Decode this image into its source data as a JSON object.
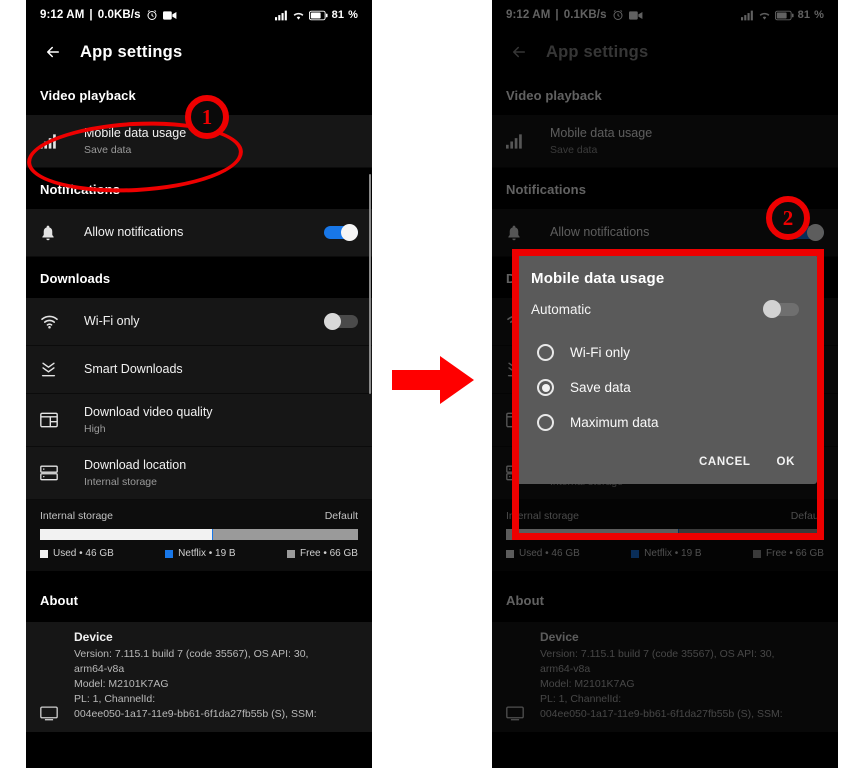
{
  "annotations": {
    "marker_1": "1",
    "marker_2": "2",
    "flow_arrow": "right-arrow"
  },
  "left_phone": {
    "status_bar": {
      "time": "9:12 AM",
      "separator": "|",
      "net_speed": "0.0KB/s",
      "alarm_icon": "alarm-clock-icon",
      "recording_icon": "screen-record-icon",
      "signal_icon": "cellular-signal-icon",
      "wifi_icon": "wifi-icon",
      "battery_icon": "battery-icon",
      "battery_level": "81"
    },
    "app_bar": {
      "back_icon": "back-arrow-icon",
      "title": "App settings"
    },
    "sections": [
      {
        "heading": "Video playback",
        "rows": [
          {
            "icon": "signal-bars-icon",
            "title": "Mobile data usage",
            "subtitle": "Save data",
            "control": "none"
          }
        ]
      },
      {
        "heading": "Notifications",
        "rows": [
          {
            "icon": "bell-icon",
            "title": "Allow notifications",
            "subtitle": "",
            "control": "toggle-on"
          }
        ]
      },
      {
        "heading": "Downloads",
        "rows": [
          {
            "icon": "wifi-icon",
            "title": "Wi-Fi only",
            "subtitle": "",
            "control": "toggle-off"
          },
          {
            "icon": "smart-downloads-icon",
            "title": "Smart Downloads",
            "subtitle": "",
            "control": "none"
          },
          {
            "icon": "video-quality-icon",
            "title": "Download video quality",
            "subtitle": "High",
            "control": "none"
          },
          {
            "icon": "storage-icon",
            "title": "Download location",
            "subtitle": "Internal storage",
            "control": "none"
          }
        ]
      }
    ],
    "storage": {
      "label": "Internal storage",
      "value": "Default",
      "legend": [
        {
          "name": "Used",
          "value": "46 GB",
          "color": "#f2f2f2"
        },
        {
          "name": "Netflix",
          "value": "19 B",
          "color": "#1877e8"
        },
        {
          "name": "Free",
          "value": "66 GB",
          "color": "#9a9a9a"
        }
      ],
      "used_percent": 54,
      "netflix_percent": 0.3,
      "free_percent": 45.7
    },
    "about": {
      "heading": "About",
      "device_title": "Device",
      "line_1": "Version: 7.115.1 build 7 (code 35567), OS API: 30,",
      "line_2": "arm64-v8a",
      "line_3": "Model: M2101K7AG",
      "line_4": "PL: 1, ChannelId:",
      "line_5": "004ee050-1a17-11e9-bb61-6f1da27fb55b (S), SSM:",
      "icon": "device-icon"
    }
  },
  "right_phone": {
    "status_bar": {
      "time": "9:12 AM",
      "separator": "|",
      "net_speed": "0.1KB/s",
      "alarm_icon": "alarm-clock-icon",
      "recording_icon": "screen-record-icon",
      "signal_icon": "cellular-signal-icon",
      "wifi_icon": "wifi-icon",
      "battery_icon": "battery-icon",
      "battery_level": "81"
    },
    "app_bar": {
      "back_icon": "back-arrow-icon",
      "title": "App settings"
    },
    "dialog": {
      "title": "Mobile data usage",
      "automatic_label": "Automatic",
      "automatic_state": "off",
      "options": [
        {
          "label": "Wi-Fi only",
          "selected": false
        },
        {
          "label": "Save data",
          "selected": true
        },
        {
          "label": "Maximum data",
          "selected": false
        }
      ],
      "cancel_label": "CANCEL",
      "ok_label": "OK"
    }
  },
  "colors": {
    "annotation_red": "#ee0000",
    "accent_blue": "#1877e8",
    "dialog_bg": "#5a5a5a",
    "row_bg": "#161616",
    "page_bg": "#000000"
  }
}
